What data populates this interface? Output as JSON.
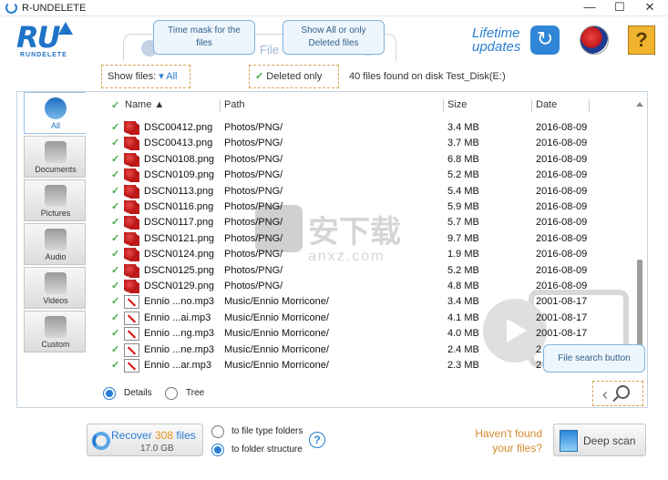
{
  "window": {
    "title": "R-UNDELETE",
    "minimize": "—",
    "maximize": "☐",
    "close": "✕"
  },
  "header": {
    "logo_text": "RU",
    "logo_sub": "RUNDELETE",
    "tab_files": "File",
    "lifetime_line1": "Lifetime",
    "lifetime_line2": "updates",
    "help_label": "?",
    "refresh_glyph": "↻"
  },
  "tooltips": {
    "time_mask": "Time mask for the files",
    "show_all": "Show All or only Deleted files",
    "file_search": "File search button"
  },
  "filter": {
    "show_files_label": "Show files:",
    "show_files_value": "▾ All",
    "deleted_only_label": "Deleted only",
    "found_text": "40 files found on disk Test_Disk(E:)"
  },
  "categories": [
    {
      "label": "All",
      "icon": "all-icon"
    },
    {
      "label": "Documents",
      "icon": "documents-icon"
    },
    {
      "label": "Pictures",
      "icon": "pictures-icon"
    },
    {
      "label": "Audio",
      "icon": "audio-icon"
    },
    {
      "label": "Videos",
      "icon": "videos-icon"
    },
    {
      "label": "Custom",
      "icon": "custom-icon"
    }
  ],
  "columns": {
    "name": "Name ▲",
    "path": "Path",
    "size": "Size",
    "date": "Date"
  },
  "files": [
    {
      "name": "DSC00412.png",
      "path": "Photos/PNG/",
      "size": "3.4 MB",
      "date": "2016-08-09",
      "type": "png"
    },
    {
      "name": "DSC00413.png",
      "path": "Photos/PNG/",
      "size": "3.7 MB",
      "date": "2016-08-09",
      "type": "png"
    },
    {
      "name": "DSCN0108.png",
      "path": "Photos/PNG/",
      "size": "6.8 MB",
      "date": "2016-08-09",
      "type": "png"
    },
    {
      "name": "DSCN0109.png",
      "path": "Photos/PNG/",
      "size": "5.2 MB",
      "date": "2016-08-09",
      "type": "png"
    },
    {
      "name": "DSCN0113.png",
      "path": "Photos/PNG/",
      "size": "5.4 MB",
      "date": "2016-08-09",
      "type": "png"
    },
    {
      "name": "DSCN0116.png",
      "path": "Photos/PNG/",
      "size": "5.9 MB",
      "date": "2016-08-09",
      "type": "png"
    },
    {
      "name": "DSCN0117.png",
      "path": "Photos/PNG/",
      "size": "5.7 MB",
      "date": "2016-08-09",
      "type": "png"
    },
    {
      "name": "DSCN0121.png",
      "path": "Photos/PNG/",
      "size": "9.7 MB",
      "date": "2016-08-09",
      "type": "png"
    },
    {
      "name": "DSCN0124.png",
      "path": "Photos/PNG/",
      "size": "1.9 MB",
      "date": "2016-08-09",
      "type": "png"
    },
    {
      "name": "DSCN0125.png",
      "path": "Photos/PNG/",
      "size": "5.2 MB",
      "date": "2016-08-09",
      "type": "png"
    },
    {
      "name": "DSCN0129.png",
      "path": "Photos/PNG/",
      "size": "4.8 MB",
      "date": "2016-08-09",
      "type": "png"
    },
    {
      "name": "Ennio ...no.mp3",
      "path": "Music/Ennio Morricone/",
      "size": "3.4 MB",
      "date": "2001-08-17",
      "type": "mp3"
    },
    {
      "name": "Ennio ...ai.mp3",
      "path": "Music/Ennio Morricone/",
      "size": "4.1 MB",
      "date": "2001-08-17",
      "type": "mp3"
    },
    {
      "name": "Ennio ...ng.mp3",
      "path": "Music/Ennio Morricone/",
      "size": "4.0 MB",
      "date": "2001-08-17",
      "type": "mp3"
    },
    {
      "name": "Ennio ...ne.mp3",
      "path": "Music/Ennio Morricone/",
      "size": "2.4 MB",
      "date": "2",
      "type": "mp3"
    },
    {
      "name": "Ennio ...ar.mp3",
      "path": "Music/Ennio Morricone/",
      "size": "2.3 MB",
      "date": "2",
      "type": "mp3"
    }
  ],
  "watermark": {
    "text": "安下载",
    "sub": "anxz.com"
  },
  "view": {
    "details": "Details",
    "tree": "Tree"
  },
  "footer": {
    "recover_prefix": "Recover ",
    "recover_count": "308",
    "recover_suffix": " files",
    "recover_size": "17.0 GB",
    "to_file_type": "to file type folders",
    "to_folder": "to folder structure",
    "help": "?",
    "havent_line1": "Haven't found",
    "havent_line2": "your files?",
    "deep_scan": "Deep scan"
  }
}
